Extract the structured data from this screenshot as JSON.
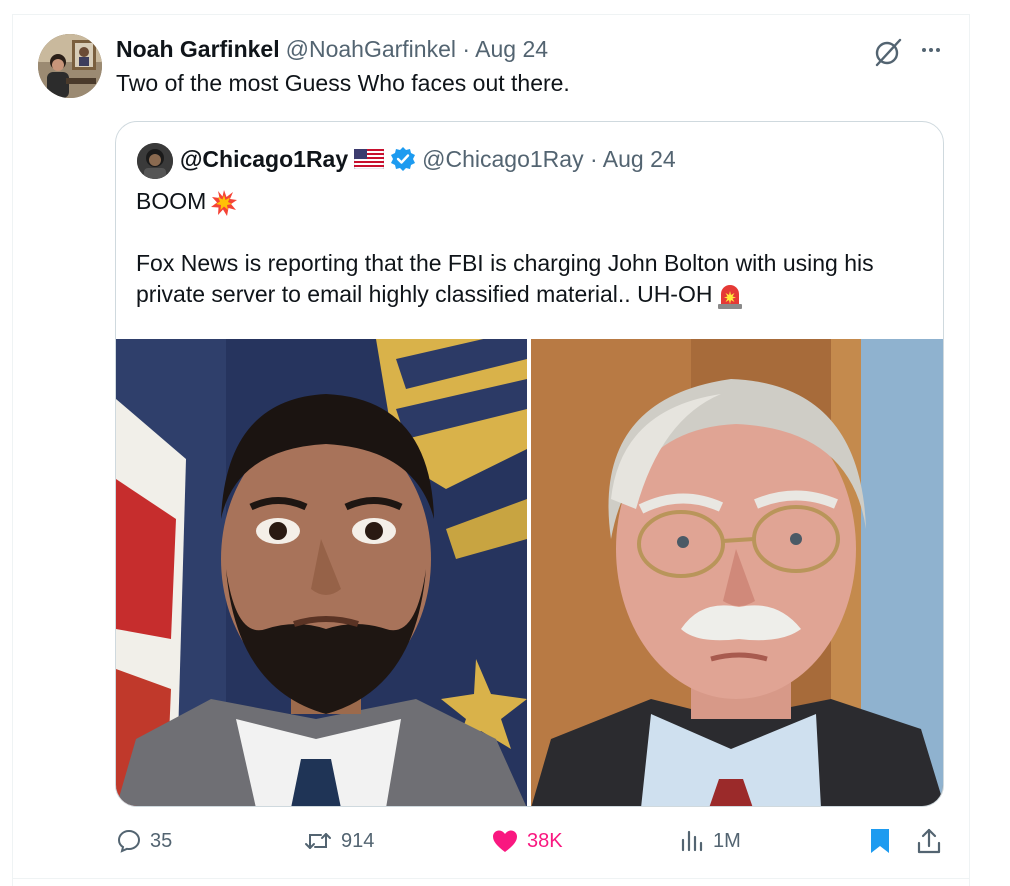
{
  "tweet": {
    "author_name": "Noah Garfinkel",
    "author_meta": "@NoahGarfinkel · Aug 24",
    "text": "Two of the most Guess Who faces out there."
  },
  "quoted": {
    "name": "@Chicago1Ray",
    "meta": "@Chicago1Ray · Aug 24",
    "line1": "BOOM",
    "line2": "Fox News is reporting that the FBI is charging John Bolton with using his",
    "line3": "private server to email highly classified material.. UH-OH"
  },
  "actions": {
    "replies": "35",
    "reposts": "914",
    "likes": "38K",
    "views": "1M"
  },
  "icons": {
    "grok": "grok-icon",
    "more": "more-icon",
    "reply": "reply-icon",
    "repost": "repost-icon",
    "like": "heart-icon",
    "views": "views-icon",
    "bookmark": "bookmark-icon",
    "share": "share-icon"
  },
  "colors": {
    "text": "#0f1419",
    "secondary": "#536471",
    "like": "#f91880",
    "accent": "#1d9bf0"
  }
}
